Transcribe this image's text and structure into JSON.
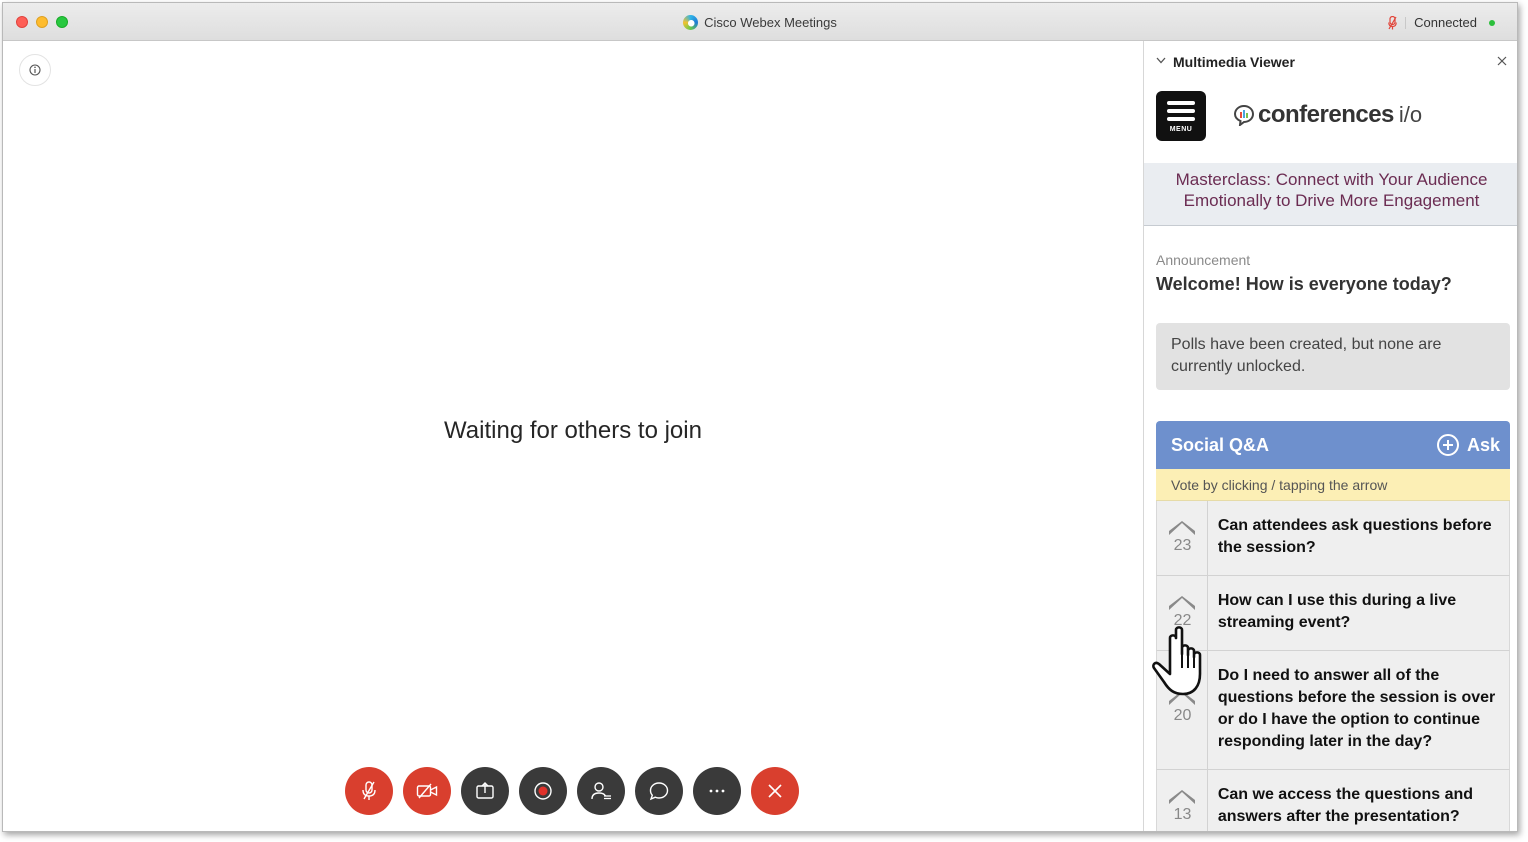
{
  "window": {
    "title": "Cisco Webex Meetings",
    "connection_status": "Connected"
  },
  "stage": {
    "waiting_message": "Waiting for others to join"
  },
  "controls": [
    {
      "name": "unmute-button",
      "icon": "mic-muted-icon",
      "color": "#d93f2e"
    },
    {
      "name": "start-video-button",
      "icon": "video-off-icon",
      "color": "#d93f2e"
    },
    {
      "name": "share-button",
      "icon": "share-icon",
      "color": "#3a3a3a"
    },
    {
      "name": "record-button",
      "icon": "record-icon",
      "color": "#3a3a3a"
    },
    {
      "name": "participants-button",
      "icon": "participants-icon",
      "color": "#3a3a3a"
    },
    {
      "name": "chat-button",
      "icon": "chat-icon",
      "color": "#3a3a3a"
    },
    {
      "name": "more-button",
      "icon": "more-icon",
      "color": "#3a3a3a"
    },
    {
      "name": "leave-button",
      "icon": "close-icon",
      "color": "#d93f2e"
    }
  ],
  "panel": {
    "title": "Multimedia Viewer",
    "menu_label": "MENU",
    "logo_word": "conferences",
    "logo_suffix": "i/o",
    "session_title": "Masterclass: Connect with Your Audience Emotionally to Drive More Engagement",
    "announcement_label": "Announcement",
    "announcement_text": "Welcome! How is everyone today?",
    "polls_notice": "Polls have been created, but none are currently unlocked.",
    "qa": {
      "title": "Social Q&A",
      "ask_label": "Ask",
      "hint": "Vote by clicking / tapping the arrow",
      "questions": [
        {
          "votes": "23",
          "text": "Can attendees ask questions before the session?"
        },
        {
          "votes": "22",
          "text": "How can I use this during a live streaming event?"
        },
        {
          "votes": "20",
          "text": "Do I need to answer all of the questions before the session is over or do I have the option to continue responding later in the day?"
        },
        {
          "votes": "13",
          "text": "Can we access the questions and answers after the presentation?"
        }
      ]
    }
  },
  "colors": {
    "accent_red": "#d93f2e",
    "qa_header": "#6e90cd",
    "session_title": "#6b2c52",
    "hint_bg": "#fcefb5"
  }
}
